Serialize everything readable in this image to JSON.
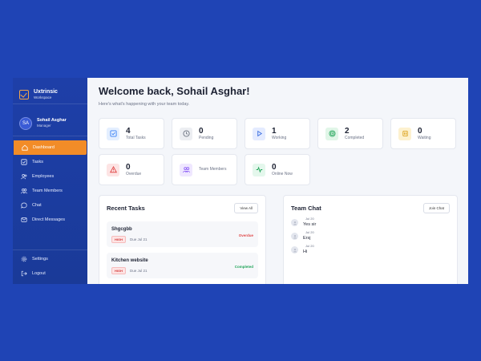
{
  "brand": {
    "name": "Uxtrinsic",
    "sub": "Workspace"
  },
  "user": {
    "initials": "SA",
    "name": "Sohail Asghar",
    "role": "Manager"
  },
  "nav": {
    "items": [
      {
        "label": "Dashboard",
        "icon": "home-icon"
      },
      {
        "label": "Tasks",
        "icon": "checkbox-icon"
      },
      {
        "label": "Employees",
        "icon": "people-icon"
      },
      {
        "label": "Team Members",
        "icon": "team-icon"
      },
      {
        "label": "Chat",
        "icon": "chat-icon"
      },
      {
        "label": "Direct Messages",
        "icon": "mail-icon"
      }
    ],
    "bottom": [
      {
        "label": "Settings",
        "icon": "gear-icon"
      },
      {
        "label": "Logout",
        "icon": "logout-icon"
      }
    ]
  },
  "header": {
    "title": "Welcome back, Sohail Asghar!",
    "subtitle": "Here's what's happening with your team today."
  },
  "stats": [
    {
      "value": "4",
      "label": "Total Tasks",
      "icon": "task-check-icon",
      "color": "#3b82f6",
      "bg": "#e4efff"
    },
    {
      "value": "0",
      "label": "Pending",
      "icon": "clock-icon",
      "color": "#6b7280",
      "bg": "#eceef2"
    },
    {
      "value": "1",
      "label": "Working",
      "icon": "play-icon",
      "color": "#3b6fe0",
      "bg": "#e4ebff"
    },
    {
      "value": "2",
      "label": "Completed",
      "icon": "target-icon",
      "color": "#22a55a",
      "bg": "#e1f6e8"
    },
    {
      "value": "0",
      "label": "Waiting",
      "icon": "pause-icon",
      "color": "#d99a0b",
      "bg": "#fdf1cf"
    },
    {
      "value": "0",
      "label": "Overdue",
      "icon": "warning-icon",
      "color": "#e04848",
      "bg": "#fde4e4"
    },
    {
      "value": "",
      "label": "Team Members",
      "icon": "team-icon",
      "color": "#8b5cf6",
      "bg": "#efe7ff"
    },
    {
      "value": "0",
      "label": "Online Now",
      "icon": "activity-icon",
      "color": "#22a55a",
      "bg": "#e4f7ec"
    }
  ],
  "recent_tasks": {
    "title": "Recent Tasks",
    "button": "View All",
    "items": [
      {
        "name": "Shgcgbb",
        "priority": "HIGH",
        "due": "Due Jul 21",
        "status": "Overdue",
        "status_color": "#e04848"
      },
      {
        "name": "Kitchen website",
        "priority": "HIGH",
        "due": "Due Jul 21",
        "status": "Completed",
        "status_color": "#22a55a"
      }
    ]
  },
  "team_chat": {
    "title": "Team Chat",
    "button": "Join Chat",
    "messages": [
      {
        "time": "Jul 20",
        "text": "Yes sir"
      },
      {
        "time": "Jul 20",
        "text": "Ersj"
      },
      {
        "time": "Jul 20",
        "text": "Hi"
      }
    ]
  }
}
